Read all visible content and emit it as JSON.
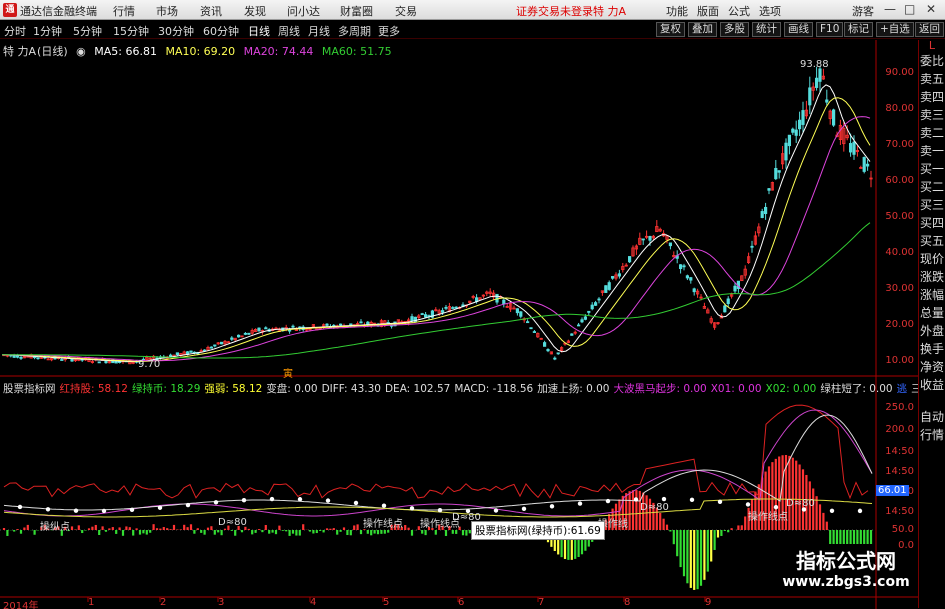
{
  "title_bar": {
    "app_name": "通达信金融终端",
    "menus": [
      "行情",
      "市场",
      "资讯",
      "发现",
      "问小达",
      "财富圈",
      "交易"
    ],
    "notice": "证券交易未登录",
    "stock_name": "特 力A",
    "right_menus": [
      "功能",
      "版面",
      "公式",
      "选项"
    ],
    "guest": "游客",
    "window_buttons": [
      "—",
      "□",
      "✕"
    ]
  },
  "period_bar": {
    "periods": [
      "分时",
      "1分钟",
      "5分钟",
      "15分钟",
      "30分钟",
      "60分钟",
      "日线",
      "周线",
      "月线",
      "多周期",
      "更多"
    ],
    "active": "日线",
    "right_tools": [
      "复权",
      "叠加",
      "多股",
      "统计",
      "画线",
      "F10",
      "标记",
      "+自选",
      "返回"
    ]
  },
  "price_header": {
    "stock": "特 力A",
    "period": "(日线)",
    "ma5": "MA5: 66.81",
    "ma10": "MA10: 69.20",
    "ma20": "MA20: 74.44",
    "ma60": "MA60: 51.75"
  },
  "price_axis": [
    "90.00",
    "80.00",
    "70.00",
    "60.00",
    "50.00",
    "40.00",
    "30.00",
    "20.00",
    "10.00"
  ],
  "price_markers": {
    "high": "93.88",
    "low": "9.70",
    "badge": "寅"
  },
  "indicator_header": [
    {
      "text": "股票指标网",
      "color": "#dddddd"
    },
    {
      "text": "红持股: 58.12",
      "color": "#ff3333"
    },
    {
      "text": "绿持币: 18.29",
      "color": "#33dd33"
    },
    {
      "text": "强弱: 58.12",
      "color": "#ffff33"
    },
    {
      "text": "变盘: 0.00",
      "color": "#dddddd"
    },
    {
      "text": "DIFF: 43.30",
      "color": "#dddddd"
    },
    {
      "text": "DEA: 102.57",
      "color": "#dddddd"
    },
    {
      "text": "MACD: -118.56",
      "color": "#dddddd"
    },
    {
      "text": "加速上扬: 0.00",
      "color": "#dddddd"
    },
    {
      "text": "大波黑马起步: 0.00",
      "color": "#dd33dd"
    },
    {
      "text": "X01: 0.00",
      "color": "#dd33dd"
    },
    {
      "text": "X02: 0.00",
      "color": "#33dd33"
    },
    {
      "text": "绿柱短了: 0.00",
      "color": "#dddddd"
    },
    {
      "text": "逃",
      "color": "#3366ff"
    },
    {
      "text": "三天: 0",
      "color": "#dddddd"
    }
  ],
  "indicator_axis": [
    "250.0",
    "200.0",
    "14:50",
    "14:50",
    "14:50",
    "14:50",
    "50.0",
    "0.0"
  ],
  "indicator_value_badge": "66.01",
  "indicator_labels": [
    "操纵点",
    "D≈80",
    "操作线点",
    "操作线点",
    "D≈80",
    "操作线",
    "D≈80",
    "操作线点",
    "D≈80"
  ],
  "tooltip": "股票指标网(绿持币):61.69",
  "date_axis": [
    "2014年",
    "1",
    "2",
    "3",
    "4",
    "5",
    "6",
    "7",
    "8",
    "9"
  ],
  "right_panel": [
    "L",
    "委比",
    "卖五",
    "卖四",
    "卖三",
    "卖二",
    "卖一",
    "买一",
    "买二",
    "买三",
    "买四",
    "买五",
    "现价",
    "涨跌",
    "涨幅",
    "总量",
    "外盘",
    "换手",
    "净资",
    "收益",
    "自动",
    "行情"
  ],
  "watermark": {
    "line1": "指标公式网",
    "line2": "www.zbgs3.com"
  },
  "colors": {
    "up": "#ff3333",
    "down": "#55dddd",
    "ma5": "#ffffff",
    "ma10": "#ffff55",
    "ma20": "#dd44dd",
    "ma60": "#33cc33",
    "axis": "#dd3333"
  }
}
